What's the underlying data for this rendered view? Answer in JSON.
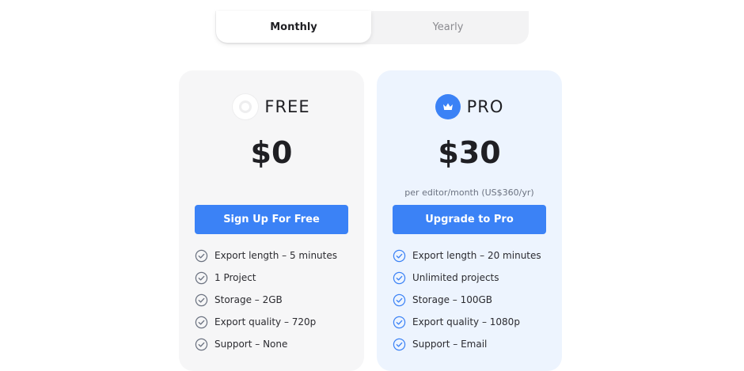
{
  "billing_toggle": {
    "monthly_label": "Monthly",
    "yearly_label": "Yearly",
    "selected": "Monthly"
  },
  "plans": [
    {
      "name": "FREE",
      "price": "$0",
      "price_note": "",
      "cta_label": "Sign Up For Free",
      "icon": "circle-logo-icon",
      "features": [
        "Export length – 5 minutes",
        "1 Project",
        "Storage – 2GB",
        "Export quality – 720p",
        "Support – None"
      ]
    },
    {
      "name": "PRO",
      "price": "$30",
      "price_note": "per editor/month (US$360/yr)",
      "cta_label": "Upgrade to Pro",
      "icon": "crown-icon",
      "features": [
        "Export length – 20 minutes",
        "Unlimited projects",
        "Storage – 100GB",
        "Export quality – 1080p",
        "Support – Email"
      ]
    }
  ],
  "colors": {
    "accent": "#3b82f6",
    "free_card_bg": "#f6f6f7",
    "pro_card_bg": "#edf4fe",
    "free_check": "#6b7280",
    "pro_check": "#3b82f6"
  }
}
